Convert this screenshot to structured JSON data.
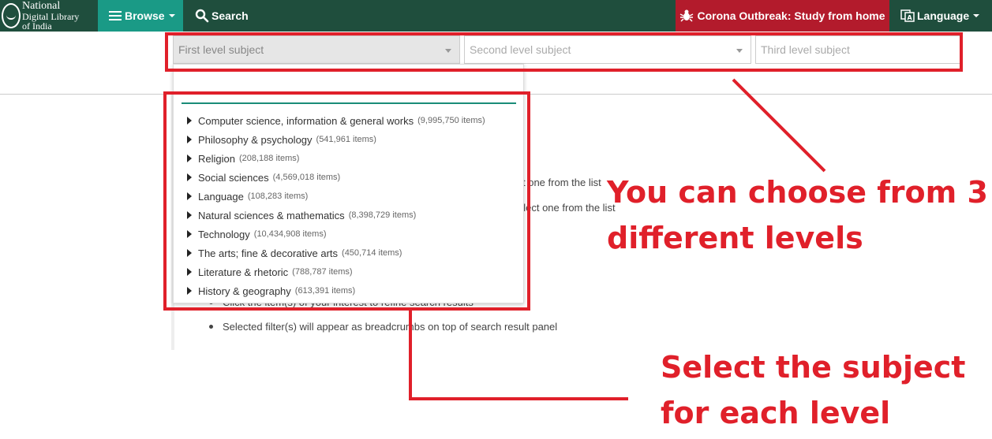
{
  "logo": {
    "line1": "National",
    "line2": "Digital Library",
    "line3": "of India"
  },
  "nav": {
    "browse_label": "Browse",
    "search_label": "Search",
    "corona_label": "Corona Outbreak: Study from home",
    "language_label": "Language"
  },
  "selectors": {
    "first": "First level subject",
    "second": "Second level subject",
    "third": "Third level subject"
  },
  "help": {
    "line1_fragment": "t one from the list",
    "line2_fragment": "elect one from the list",
    "line3_partial": "Click the item(s) of your interest to refine search results",
    "line4": "Selected filter(s) will appear as breadcrumbs on top of search result panel"
  },
  "subjects": [
    {
      "name": "Computer science, information & general works",
      "count": "(9,995,750 items)"
    },
    {
      "name": "Philosophy & psychology",
      "count": "(541,961 items)"
    },
    {
      "name": "Religion",
      "count": "(208,188 items)"
    },
    {
      "name": "Social sciences",
      "count": "(4,569,018 items)"
    },
    {
      "name": "Language",
      "count": "(108,283 items)"
    },
    {
      "name": "Natural sciences & mathematics",
      "count": "(8,398,729 items)"
    },
    {
      "name": "Technology",
      "count": "(10,434,908 items)"
    },
    {
      "name": "The arts; fine & decorative arts",
      "count": "(450,714 items)"
    },
    {
      "name": "Literature & rhetoric",
      "count": "(788,787 items)"
    },
    {
      "name": "History & geography",
      "count": "(613,391 items)"
    }
  ],
  "annotations": {
    "levels_line1": "You can choose from 3",
    "levels_line2": "different levels",
    "select_line1": "Select the subject",
    "select_line2": "for each level"
  },
  "colors": {
    "nav_bg": "#1f4e3d",
    "browse_bg": "#1a9a86",
    "corona_bg": "#b31b2c",
    "annotation_red": "#e0202a"
  }
}
